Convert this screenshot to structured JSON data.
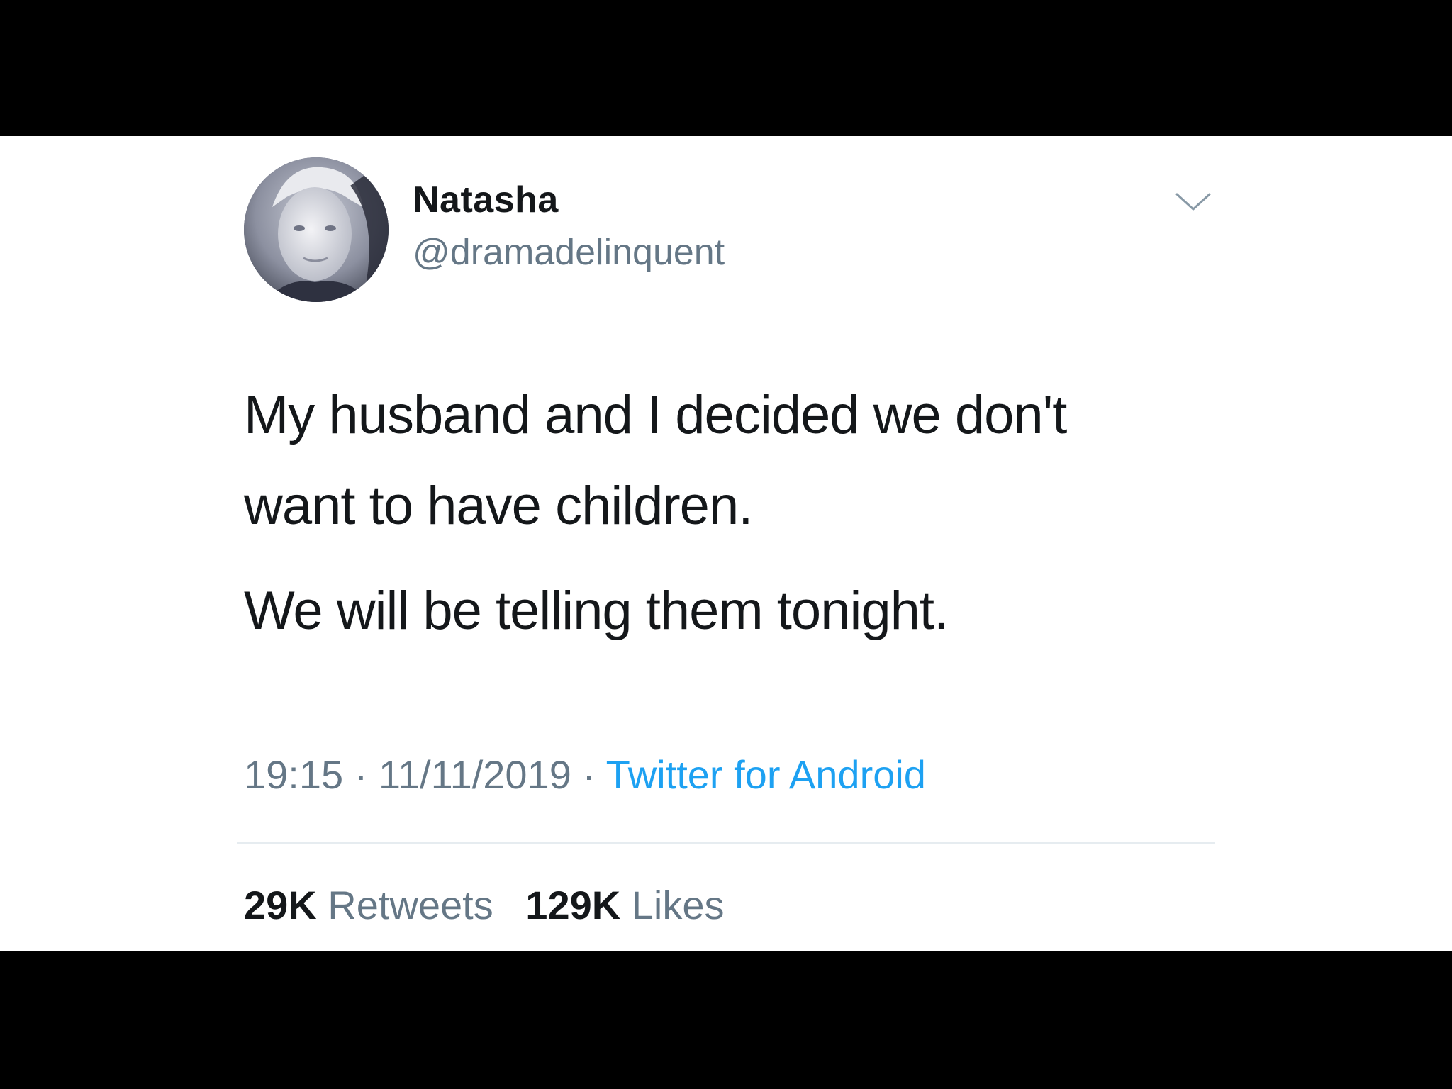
{
  "tweet": {
    "author": {
      "display_name": "Natasha",
      "handle": "@dramadelinquent"
    },
    "text_lines": [
      "My husband and I decided we don't",
      "want to have children.",
      "We will be telling them tonight."
    ],
    "meta": {
      "time": "19:15",
      "separator": " · ",
      "date": "11/11/2019",
      "source": "Twitter for Android"
    },
    "stats": {
      "retweets_count": "29K",
      "retweets_label": "Retweets",
      "likes_count": "129K",
      "likes_label": "Likes"
    },
    "icons": {
      "menu": "chevron-down-icon",
      "avatar": "profile-photo"
    }
  },
  "colors": {
    "text_primary": "#14171a",
    "text_secondary": "#657786",
    "link": "#1da1f2",
    "divider": "#e6ecf0",
    "letterbox": "#000000"
  }
}
